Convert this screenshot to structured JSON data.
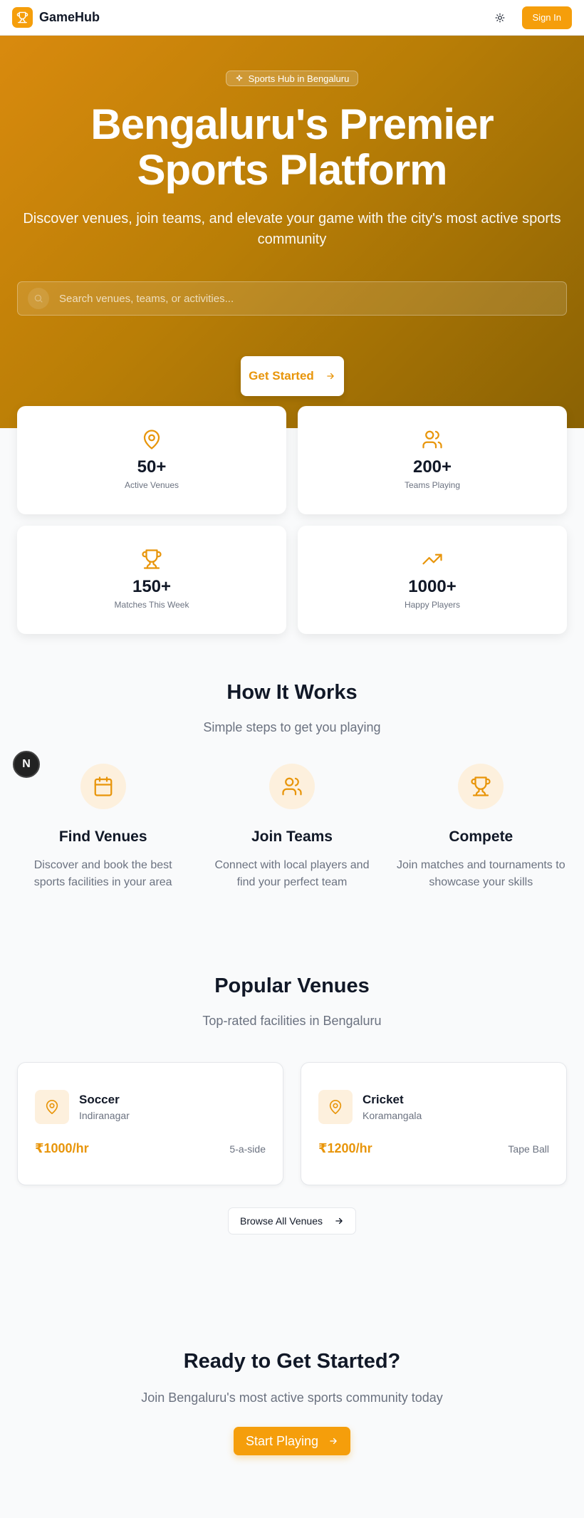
{
  "header": {
    "brand": "GameHub",
    "sign_in": "Sign In"
  },
  "hero": {
    "badge": "Sports Hub in Bengaluru",
    "title": "Bengaluru's Premier Sports Platform",
    "subtitle": "Discover venues, join teams, and elevate your game with the city's most active sports community",
    "search_placeholder": "Search venues, teams, or activities...",
    "cta": "Get Started"
  },
  "stats": [
    {
      "icon": "map-pin-icon",
      "value": "50+",
      "label": "Active Venues"
    },
    {
      "icon": "users-icon",
      "value": "200+",
      "label": "Teams Playing"
    },
    {
      "icon": "trophy-icon",
      "value": "150+",
      "label": "Matches This Week"
    },
    {
      "icon": "trending-up-icon",
      "value": "1000+",
      "label": "Happy Players"
    }
  ],
  "how": {
    "title": "How It Works",
    "subtitle": "Simple steps to get you playing",
    "steps": [
      {
        "icon": "calendar-icon",
        "title": "Find Venues",
        "desc": "Discover and book the best sports facilities in your area"
      },
      {
        "icon": "users-icon",
        "title": "Join Teams",
        "desc": "Connect with local players and find your perfect team"
      },
      {
        "icon": "trophy-icon",
        "title": "Compete",
        "desc": "Join matches and tournaments to showcase your skills"
      }
    ]
  },
  "floating_badge": "N",
  "venues": {
    "title": "Popular Venues",
    "subtitle": "Top-rated facilities in Bengaluru",
    "items": [
      {
        "sport": "Soccer",
        "location": "Indiranagar",
        "price": "₹1000/hr",
        "format": "5-a-side"
      },
      {
        "sport": "Cricket",
        "location": "Koramangala",
        "price": "₹1200/hr",
        "format": "Tape Ball"
      }
    ],
    "browse": "Browse All Venues"
  },
  "final_cta": {
    "title": "Ready to Get Started?",
    "subtitle": "Join Bengaluru's most active sports community today",
    "button": "Start Playing"
  },
  "colors": {
    "accent": "#f59e0b",
    "accent_text": "#e8950a",
    "accent_soft": "#fdf0dd"
  }
}
